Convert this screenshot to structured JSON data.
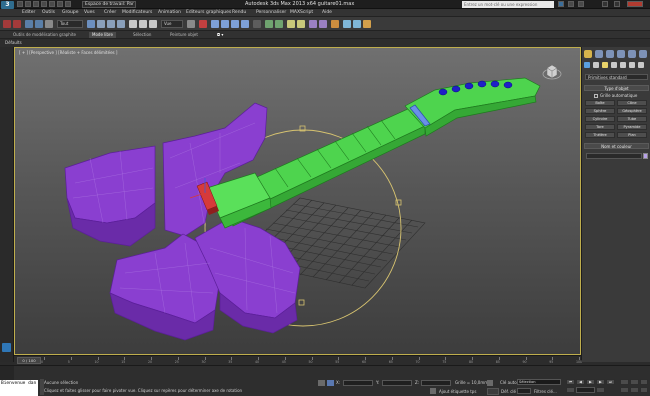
{
  "app": {
    "title": "Autodesk 3ds Max  2013 x64      guitare01.max",
    "logo_glyph": "3",
    "workspace": "Espace de travail: Par",
    "search_placeholder": "Entrez un mot-clé ou une expression"
  },
  "menubar": {
    "items": [
      "Editer",
      "Outils",
      "Groupe",
      "Vues",
      "Créer",
      "Modificateurs",
      "Animation",
      "Editeurs graphiques",
      "Rendu",
      "Personnaliser",
      "MAXScript",
      "Aide"
    ]
  },
  "main_toolbar": {
    "selection_filter": "Tout",
    "ref_coord": "Vue"
  },
  "ribbon": {
    "tabs": [
      "Outils de modélisation graphite",
      "Mode libre",
      "Sélection",
      "Peinture objet"
    ]
  },
  "subbar": {
    "label": "Défaults"
  },
  "viewport": {
    "label": "[ + ] [Perspective ] [Réaliste + Faces délimitées ]"
  },
  "command_panel": {
    "primitive_type": "Primitives standard",
    "object_type_title": "Type d'objet",
    "autogrid_label": "Grille automatique",
    "buttons": [
      "Boîte",
      "Cône",
      "Sphère",
      "Géosphère",
      "Cylindre",
      "Tube",
      "Tore",
      "Pyramide",
      "Théière",
      "Plan"
    ],
    "name_color_title": "Nom et couleur",
    "swatch_color": "#b7a1e8"
  },
  "timeline": {
    "frame_display": "0 / 100",
    "ticks": [
      "0",
      "5",
      "10",
      "15",
      "20",
      "25",
      "30",
      "35",
      "40",
      "45",
      "50",
      "55",
      "60",
      "65",
      "70",
      "75",
      "80",
      "85",
      "90",
      "95",
      "100"
    ]
  },
  "statusbar": {
    "maxscript_text": "Bienvenue dan",
    "selection_status": "Aucune sélection",
    "prompt": "Cliquez et faites glisser pour faire pivoter vue. Cliquez sur repères pour déterminer axe de rotation",
    "x_label": "X:",
    "y_label": "Y:",
    "z_label": "Z:",
    "grid_label": "Grille = 10,0mm",
    "add_time_tag": "Ajout étiquette tps",
    "auto_key_label": "Clé auto",
    "set_key_label": "Déf. clé",
    "selection_dd": "Sélection",
    "key_filters": "Filtres clé..."
  }
}
